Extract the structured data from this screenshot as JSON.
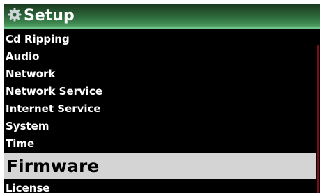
{
  "header": {
    "title": "Setup",
    "icon": "gear-icon"
  },
  "menu": {
    "items": [
      {
        "label": "Cd Ripping"
      },
      {
        "label": "Audio"
      },
      {
        "label": "Network"
      },
      {
        "label": "Network Service"
      },
      {
        "label": "Internet Service"
      },
      {
        "label": "System"
      },
      {
        "label": "Time"
      },
      {
        "label": "Firmware"
      },
      {
        "label": "License"
      }
    ],
    "selected_label": "Firmware"
  },
  "colors": {
    "title_bar": "#2e6a3c",
    "title_underline": "#6ec486",
    "background": "#000000",
    "selection": "#d4d4d4",
    "scroll_thumb": "#7a0d17"
  }
}
